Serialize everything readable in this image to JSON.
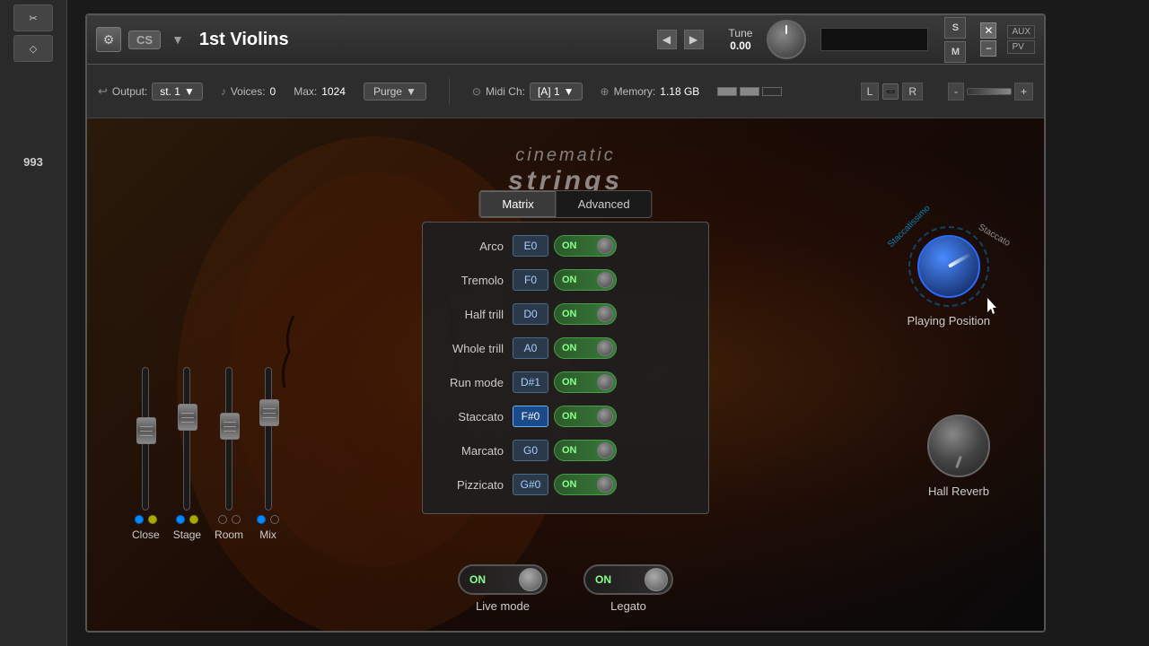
{
  "sidebar": {
    "number": "993"
  },
  "titlebar": {
    "instrument": "1st Violins",
    "icon": "⚙"
  },
  "infobar": {
    "output_label": "Output:",
    "output_value": "st. 1",
    "voices_label": "Voices:",
    "voices_value": "0",
    "max_label": "Max:",
    "max_value": "1024",
    "purge_label": "Purge",
    "midi_label": "Midi Ch:",
    "midi_value": "[A] 1",
    "memory_label": "Memory:",
    "memory_value": "1.18 GB"
  },
  "tune": {
    "label": "Tune",
    "value": "0.00"
  },
  "logo": {
    "line1": "cinematic",
    "line2": "strings"
  },
  "tabs": {
    "matrix_label": "Matrix",
    "advanced_label": "Advanced"
  },
  "matrix": {
    "rows": [
      {
        "name": "Arco",
        "key": "E0",
        "highlighted": false,
        "toggle": "ON"
      },
      {
        "name": "Tremolo",
        "key": "F0",
        "highlighted": false,
        "toggle": "ON"
      },
      {
        "name": "Half trill",
        "key": "D0",
        "highlighted": false,
        "toggle": "ON"
      },
      {
        "name": "Whole trill",
        "key": "A0",
        "highlighted": false,
        "toggle": "ON"
      },
      {
        "name": "Run mode",
        "key": "D#1",
        "highlighted": false,
        "toggle": "ON"
      },
      {
        "name": "Staccato",
        "key": "F#0",
        "highlighted": true,
        "toggle": "ON"
      },
      {
        "name": "Marcato",
        "key": "G0",
        "highlighted": false,
        "toggle": "ON"
      },
      {
        "name": "Pizzicato",
        "key": "G#0",
        "highlighted": false,
        "toggle": "ON"
      }
    ]
  },
  "playing_position": {
    "label": "Playing Position",
    "text_left": "Staccatissimo",
    "text_right": "Staccato"
  },
  "hall_reverb": {
    "label": "Hall Reverb"
  },
  "faders": [
    {
      "label": "Close",
      "dot1": "blue",
      "dot2": "yellow",
      "pos": 55
    },
    {
      "label": "Stage",
      "dot1": "blue",
      "dot2": "yellow",
      "pos": 40
    },
    {
      "label": "Room",
      "dot1": "empty",
      "dot2": "empty",
      "pos": 50
    },
    {
      "label": "Mix",
      "dot1": "blue",
      "dot2": "empty",
      "pos": 35
    }
  ],
  "bottom": {
    "live_mode_label": "Live mode",
    "live_mode_on": "ON",
    "legato_label": "Legato",
    "legato_on": "ON"
  },
  "controls": {
    "aux_label": "AUX",
    "pv_label": "PV",
    "l_label": "L",
    "r_label": "R",
    "plus_label": "+",
    "minus_label": "-"
  }
}
